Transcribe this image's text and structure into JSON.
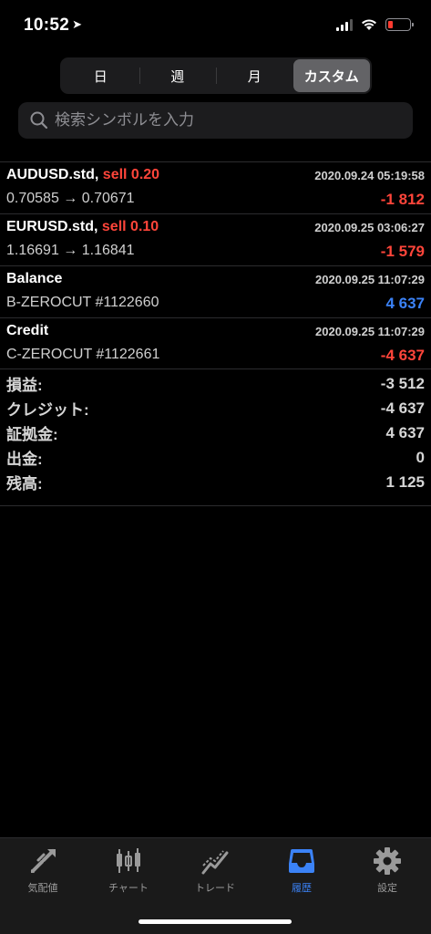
{
  "status_bar": {
    "time": "10:52",
    "location_arrow": "➤"
  },
  "segments": [
    {
      "label": "日",
      "active": false
    },
    {
      "label": "週",
      "active": false
    },
    {
      "label": "月",
      "active": false
    },
    {
      "label": "カスタム",
      "active": true
    }
  ],
  "search": {
    "placeholder": "検索シンボルを入力",
    "value": ""
  },
  "history": [
    {
      "symbol": "AUDUSD.std,",
      "side": "sell 0.20",
      "prices": "0.70585 → 0.70671",
      "date": "2020.09.24 05:19:58",
      "amount": "-1 812",
      "amount_color": "#ff453a"
    },
    {
      "symbol": "EURUSD.std,",
      "side": "sell 0.10",
      "prices": "1.16691 → 1.16841",
      "date": "2020.09.25 03:06:27",
      "amount": "-1 579",
      "amount_color": "#ff453a"
    },
    {
      "symbol": "Balance",
      "side": "",
      "prices": "B-ZEROCUT #1122660",
      "date": "2020.09.25 11:07:29",
      "amount": "4 637",
      "amount_color": "#3b82f6"
    },
    {
      "symbol": "Credit",
      "side": "",
      "prices": "C-ZEROCUT #1122661",
      "date": "2020.09.25 11:07:29",
      "amount": "-4 637",
      "amount_color": "#ff453a"
    }
  ],
  "summary": [
    {
      "label": "損益:",
      "value": "-3 512"
    },
    {
      "label": "クレジット:",
      "value": "-4 637"
    },
    {
      "label": "証拠金:",
      "value": "4 637"
    },
    {
      "label": "出金:",
      "value": "0"
    },
    {
      "label": "残高:",
      "value": "1 125"
    }
  ],
  "tabs": [
    {
      "label": "気配値",
      "icon": "quotes-arrows-icon",
      "active": false
    },
    {
      "label": "チャート",
      "icon": "candlestick-chart-icon",
      "active": false
    },
    {
      "label": "トレード",
      "icon": "trade-line-icon",
      "active": false
    },
    {
      "label": "履歴",
      "icon": "history-inbox-icon",
      "active": true
    },
    {
      "label": "設定",
      "icon": "gear-icon",
      "active": false
    }
  ],
  "colors": {
    "negative": "#ff453a",
    "positive": "#3b82f6",
    "active_tab": "#3b82f6",
    "inactive_tab": "#9a9a9a"
  }
}
